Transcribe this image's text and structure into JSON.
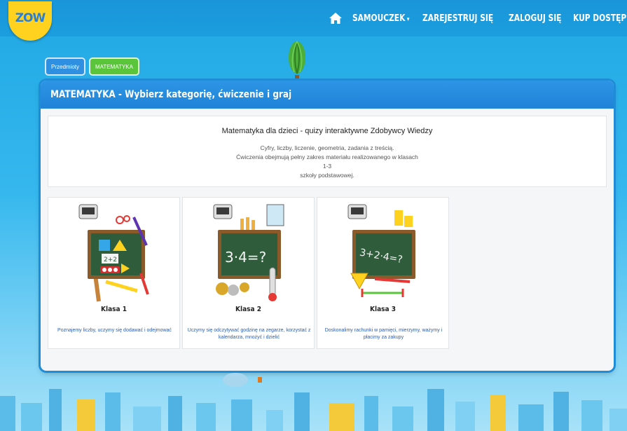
{
  "logo": {
    "text": "ZOW"
  },
  "nav": {
    "items": [
      {
        "label": "SAMOUCZEK",
        "caret": "▾"
      },
      {
        "label": "ZAREJESTRUJ SIĘ",
        "caret": ""
      },
      {
        "label": "ZALOGUJ SIĘ",
        "caret": ""
      },
      {
        "label": "KUP DOSTĘP",
        "caret": ""
      }
    ]
  },
  "breadcrumbs": [
    "Przedmioty",
    "MATEMATYKA"
  ],
  "panel": {
    "title": "MATEMATYKA - Wybierz kategorię, ćwiczenie i graj",
    "intro_title": "Matematyka dla dzieci - quizy interaktywne Zdobywcy Wiedzy",
    "intro_lines": [
      "Cyfry, liczby, liczenie, geometria, zadania z treścią.",
      "Ćwiczenia obejmują pełny zakres materiału realizowanego w klasach 1-3",
      "szkoły podstawowej."
    ]
  },
  "cards": [
    {
      "title": "Klasa 1",
      "desc": "Poznajemy liczby, uczymy się dodawać i odejmować",
      "board": "2+2"
    },
    {
      "title": "Klasa 2",
      "desc": "Uczymy się odczytywać godzinę na zegarze, korzystać z kalendarza, mnożyć i dzielić",
      "board": "3·4=?"
    },
    {
      "title": "Klasa 3",
      "desc": "Doskonalimy rachunki w pamięci, mierzymy, ważymy i płacimy za zakupy",
      "board": "3+2·4=?"
    }
  ],
  "colors": {
    "header_blue": "#1b9ede",
    "panel_blue": "#1f83d6",
    "crumb_blue": "#2f8fe0",
    "crumb_green": "#5ac43a",
    "logo_yellow": "#ffd21f",
    "desc_link": "#2a5db5"
  }
}
